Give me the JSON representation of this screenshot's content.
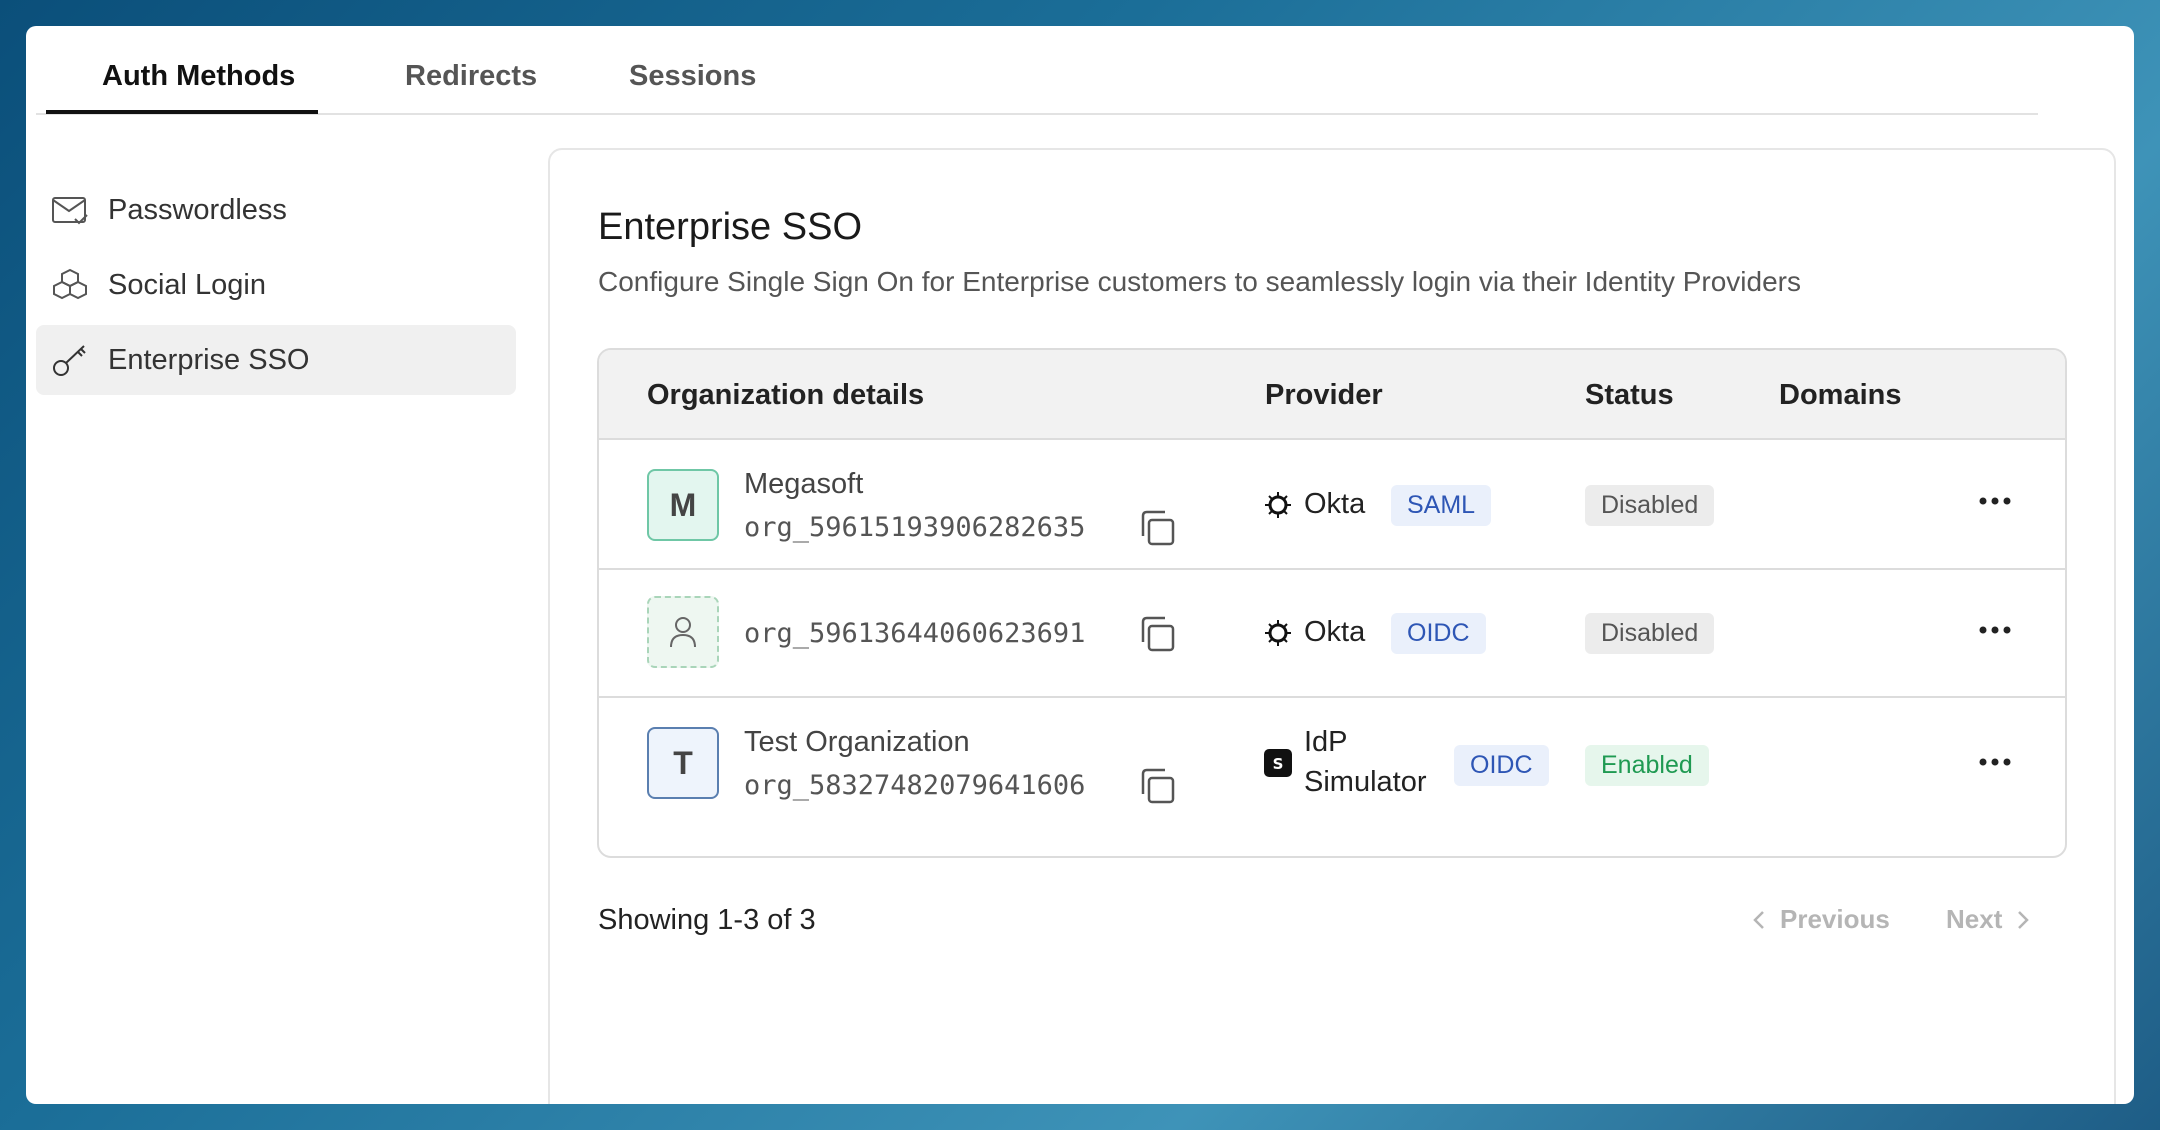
{
  "tabs": [
    {
      "label": "Auth Methods",
      "active": true
    },
    {
      "label": "Redirects",
      "active": false
    },
    {
      "label": "Sessions",
      "active": false
    }
  ],
  "sidebar": {
    "items": [
      {
        "label": "Passwordless",
        "icon": "mail-check-icon",
        "active": false
      },
      {
        "label": "Social Login",
        "icon": "boxes-icon",
        "active": false
      },
      {
        "label": "Enterprise SSO",
        "icon": "key-icon",
        "active": true
      }
    ]
  },
  "main": {
    "title": "Enterprise SSO",
    "subtitle": "Configure Single Sign On for Enterprise customers to seamlessly login via their Identity Providers"
  },
  "table": {
    "columns": [
      "Organization details",
      "Provider",
      "Status",
      "Domains"
    ],
    "rows": [
      {
        "avatar": "M",
        "name": "Megasoft",
        "org_id": "org_59615193906282635",
        "provider": "Okta",
        "protocol": "SAML",
        "status": "Disabled",
        "domains": ""
      },
      {
        "avatar": "",
        "name": "",
        "org_id": "org_59613644060623691",
        "provider": "Okta",
        "protocol": "OIDC",
        "status": "Disabled",
        "domains": ""
      },
      {
        "avatar": "T",
        "name": "Test Organization",
        "org_id": "org_58327482079641606",
        "provider_line1": "IdP",
        "provider_line2": "Simulator",
        "protocol": "OIDC",
        "status": "Enabled",
        "domains": ""
      }
    ]
  },
  "pagination": {
    "showing": "Showing 1-3 of 3",
    "previous": "Previous",
    "next": "Next"
  },
  "colors": {
    "accent_text": "#111111",
    "saml_oidc_badge": "#2e56b5",
    "enabled": "#1f9a52",
    "disabled": "#555555"
  }
}
